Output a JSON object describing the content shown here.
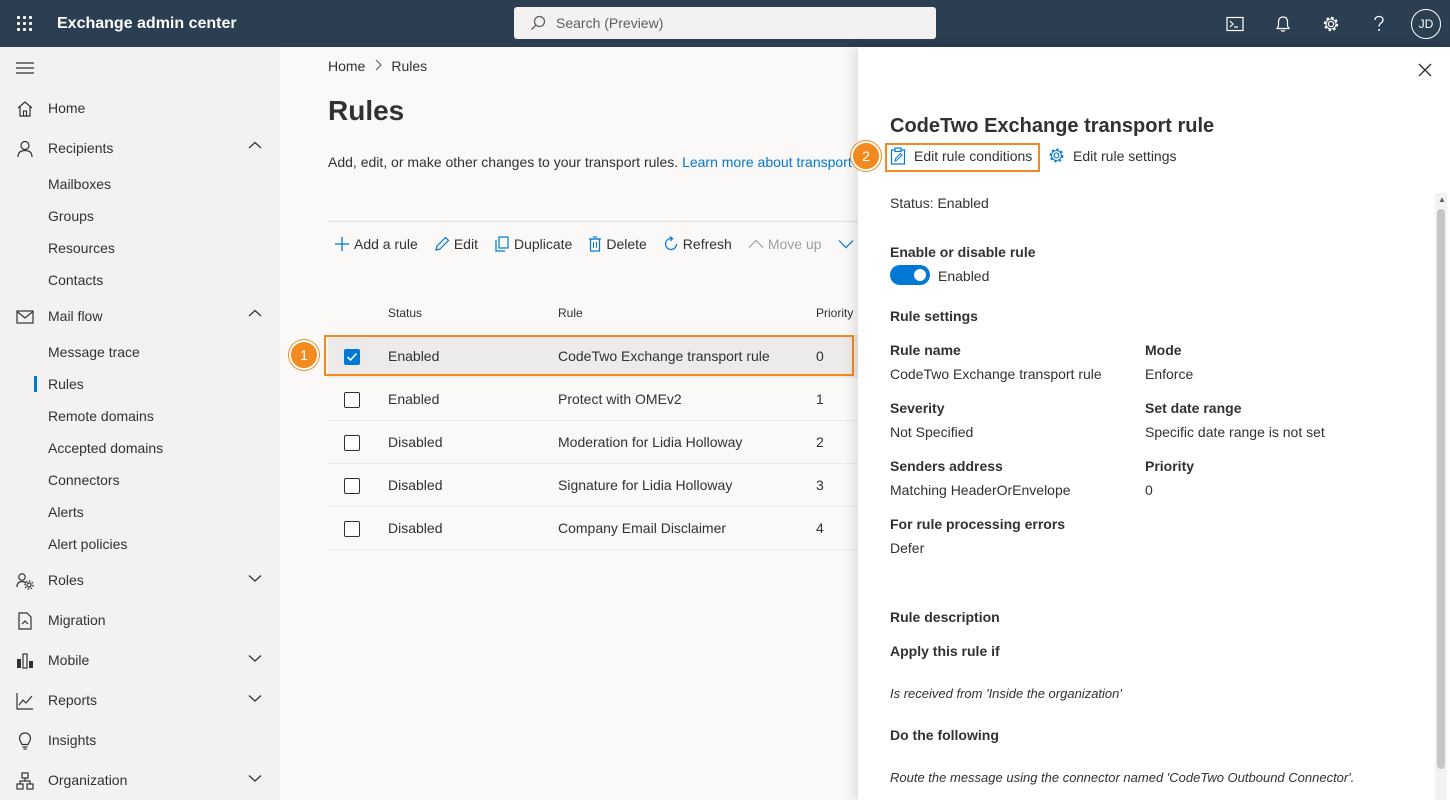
{
  "topbar": {
    "app_title": "Exchange admin center",
    "search_placeholder": "Search (Preview)",
    "avatar_initials": "JD"
  },
  "sidebar": {
    "items": [
      {
        "label": "Home",
        "icon": "home-icon"
      },
      {
        "label": "Recipients",
        "icon": "person-icon",
        "expanded": true
      },
      {
        "label": "Mailboxes"
      },
      {
        "label": "Groups"
      },
      {
        "label": "Resources"
      },
      {
        "label": "Contacts"
      },
      {
        "label": "Mail flow",
        "icon": "mail-icon",
        "expanded": true
      },
      {
        "label": "Message trace"
      },
      {
        "label": "Rules",
        "active": true
      },
      {
        "label": "Remote domains"
      },
      {
        "label": "Accepted domains"
      },
      {
        "label": "Connectors"
      },
      {
        "label": "Alerts"
      },
      {
        "label": "Alert policies"
      },
      {
        "label": "Roles",
        "icon": "roles-icon",
        "expanded": false
      },
      {
        "label": "Migration",
        "icon": "migration-icon"
      },
      {
        "label": "Mobile",
        "icon": "mobile-icon",
        "expanded": false
      },
      {
        "label": "Reports",
        "icon": "reports-icon",
        "expanded": false
      },
      {
        "label": "Insights",
        "icon": "lightbulb-icon"
      },
      {
        "label": "Organization",
        "icon": "organization-icon",
        "expanded": false
      }
    ]
  },
  "main": {
    "breadcrumb": {
      "home": "Home",
      "current": "Rules"
    },
    "title": "Rules",
    "description": "Add, edit, or make other changes to your transport rules.",
    "learn_more": "Learn more about transport rules",
    "commands": {
      "add": "Add a rule",
      "edit": "Edit",
      "duplicate": "Duplicate",
      "delete": "Delete",
      "refresh": "Refresh",
      "move_up": "Move up"
    },
    "table": {
      "headers": {
        "status": "Status",
        "rule": "Rule",
        "priority": "Priority"
      },
      "rows": [
        {
          "status": "Enabled",
          "rule": "CodeTwo Exchange transport rule",
          "priority": "0",
          "checked": true
        },
        {
          "status": "Enabled",
          "rule": "Protect with OMEv2",
          "priority": "1",
          "checked": false
        },
        {
          "status": "Disabled",
          "rule": "Moderation for Lidia Holloway",
          "priority": "2",
          "checked": false
        },
        {
          "status": "Disabled",
          "rule": "Signature for Lidia Holloway",
          "priority": "3",
          "checked": false
        },
        {
          "status": "Disabled",
          "rule": "Company Email Disclaimer",
          "priority": "4",
          "checked": false
        }
      ]
    }
  },
  "callouts": {
    "one": "1",
    "two": "2"
  },
  "panel": {
    "title": "CodeTwo Exchange transport rule",
    "edit_conditions": "Edit rule conditions",
    "edit_settings": "Edit rule settings",
    "status": "Status: Enabled",
    "enable_heading": "Enable or disable rule",
    "toggle_label": "Enabled",
    "toggle_on": true,
    "settings_heading": "Rule settings",
    "fields": {
      "rule_name_label": "Rule name",
      "rule_name_value": "CodeTwo Exchange transport rule",
      "mode_label": "Mode",
      "mode_value": "Enforce",
      "severity_label": "Severity",
      "severity_value": "Not Specified",
      "date_range_label": "Set date range",
      "date_range_value": "Specific date range is not set",
      "senders_label": "Senders address",
      "senders_value": "Matching HeaderOrEnvelope",
      "priority_label": "Priority",
      "priority_value": "0",
      "errors_label": "For rule processing errors",
      "errors_value": "Defer"
    },
    "description_heading": "Rule description",
    "apply_heading": "Apply this rule if",
    "apply_value": "Is received from 'Inside the organization'",
    "do_heading": "Do the following",
    "do_value": "Route the message using the connector named 'CodeTwo Outbound Connector'."
  }
}
